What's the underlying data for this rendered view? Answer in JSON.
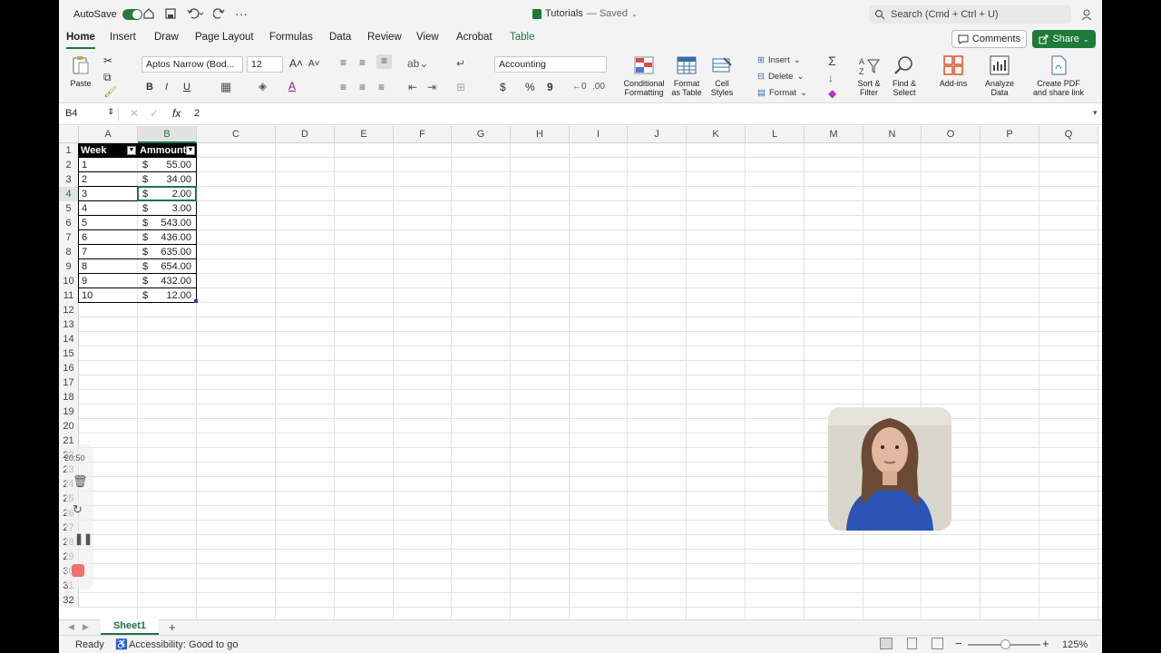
{
  "titlebar": {
    "autosave_label": "AutoSave",
    "doc_title": "Tutorials",
    "doc_status": "— Saved",
    "search_placeholder": "Search (Cmd + Ctrl + U)"
  },
  "tabs": [
    "Home",
    "Insert",
    "Draw",
    "Page Layout",
    "Formulas",
    "Data",
    "Review",
    "View",
    "Acrobat",
    "Table"
  ],
  "actions": {
    "comments": "Comments",
    "share": "Share"
  },
  "ribbon": {
    "paste": "Paste",
    "font_name": "Aptos Narrow (Bod...",
    "font_size": "12",
    "number_format": "Accounting",
    "bold": "B",
    "italic": "I",
    "underline": "U",
    "currency": "$",
    "percent": "%",
    "comma": "9",
    "conditional_formatting": [
      "Conditional",
      "Formatting"
    ],
    "format_as_table": [
      "Format",
      "as Table"
    ],
    "cell_styles": [
      "Cell",
      "Styles"
    ],
    "insert": "Insert",
    "delete": "Delete",
    "format": "Format",
    "sort_filter": [
      "Sort &",
      "Filter"
    ],
    "find_select": [
      "Find &",
      "Select"
    ],
    "addins": "Add-ins",
    "analyze_data": [
      "Analyze",
      "Data"
    ],
    "create_pdf": [
      "Create PDF",
      "and share link"
    ]
  },
  "formula_bar": {
    "name_box": "B4",
    "fx": "fx",
    "value": "2"
  },
  "columns": [
    "A",
    "B",
    "C",
    "D",
    "E",
    "F",
    "G",
    "H",
    "I",
    "J",
    "K",
    "L",
    "M",
    "N",
    "O",
    "P",
    "Q"
  ],
  "rows": [
    "1",
    "2",
    "3",
    "4",
    "5",
    "6",
    "7",
    "8",
    "9",
    "10",
    "11",
    "12",
    "13",
    "14",
    "15",
    "16",
    "17",
    "18",
    "19",
    "20",
    "21",
    "22",
    "23",
    "24",
    "25",
    "26",
    "27",
    "28",
    "29",
    "30",
    "31",
    "32"
  ],
  "table": {
    "headers": [
      "Week",
      "Ammount"
    ],
    "currency_symbol": "$",
    "rows": [
      {
        "week": "1",
        "amount": "55.00"
      },
      {
        "week": "2",
        "amount": "34.00"
      },
      {
        "week": "3",
        "amount": "2.00"
      },
      {
        "week": "4",
        "amount": "3.00"
      },
      {
        "week": "5",
        "amount": "543.00"
      },
      {
        "week": "6",
        "amount": "436.00"
      },
      {
        "week": "7",
        "amount": "635.00"
      },
      {
        "week": "8",
        "amount": "654.00"
      },
      {
        "week": "9",
        "amount": "432.00"
      },
      {
        "week": "10",
        "amount": "12.00"
      }
    ]
  },
  "recorder": {
    "time": "20:50"
  },
  "sheets": {
    "active": "Sheet1",
    "add": "+"
  },
  "status": {
    "ready": "Ready",
    "accessibility": "Accessibility: Good to go",
    "zoom": "125%"
  },
  "colors": {
    "accent": "#217346",
    "share_bg": "#1e7b3a",
    "table_header_bg": "#000000"
  }
}
